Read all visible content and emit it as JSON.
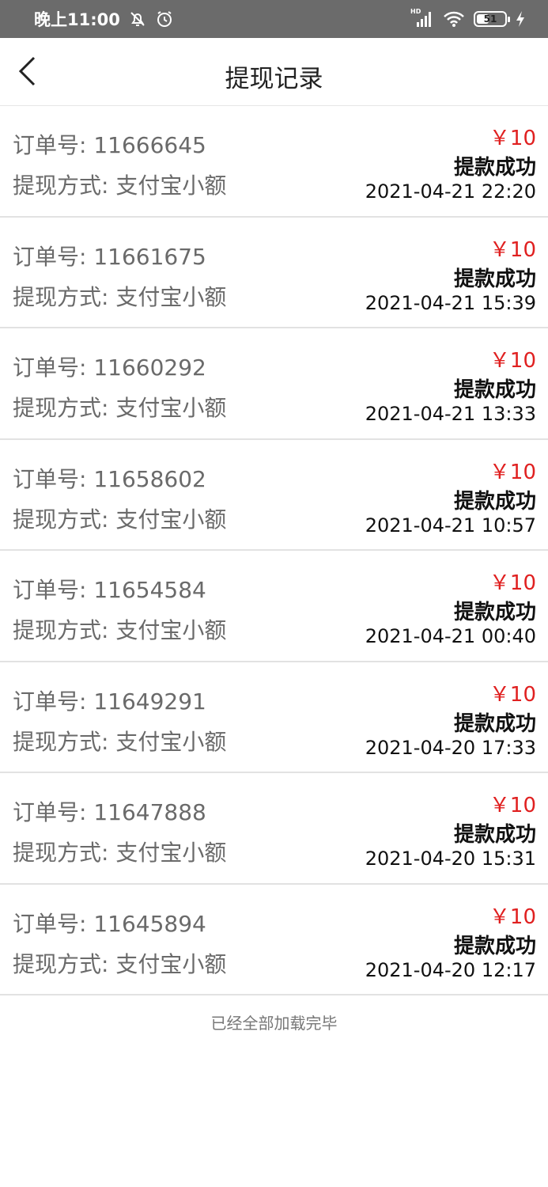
{
  "status_bar": {
    "time": "晚上11:00",
    "network_label": "HD",
    "battery_level": "51",
    "battery_percent": 51
  },
  "header": {
    "title": "提现记录"
  },
  "records": [
    {
      "order_label": "订单号: 11666645",
      "method_label": "提现方式: 支付宝小额",
      "amount": "￥10",
      "status": "提款成功",
      "time": "2021-04-21 22:20"
    },
    {
      "order_label": "订单号: 11661675",
      "method_label": "提现方式: 支付宝小额",
      "amount": "￥10",
      "status": "提款成功",
      "time": "2021-04-21 15:39"
    },
    {
      "order_label": "订单号: 11660292",
      "method_label": "提现方式: 支付宝小额",
      "amount": "￥10",
      "status": "提款成功",
      "time": "2021-04-21 13:33"
    },
    {
      "order_label": "订单号: 11658602",
      "method_label": "提现方式: 支付宝小额",
      "amount": "￥10",
      "status": "提款成功",
      "time": "2021-04-21 10:57"
    },
    {
      "order_label": "订单号: 11654584",
      "method_label": "提现方式: 支付宝小额",
      "amount": "￥10",
      "status": "提款成功",
      "time": "2021-04-21 00:40"
    },
    {
      "order_label": "订单号: 11649291",
      "method_label": "提现方式: 支付宝小额",
      "amount": "￥10",
      "status": "提款成功",
      "time": "2021-04-20 17:33"
    },
    {
      "order_label": "订单号: 11647888",
      "method_label": "提现方式: 支付宝小额",
      "amount": "￥10",
      "status": "提款成功",
      "time": "2021-04-20 15:31"
    },
    {
      "order_label": "订单号: 11645894",
      "method_label": "提现方式: 支付宝小额",
      "amount": "￥10",
      "status": "提款成功",
      "time": "2021-04-20 12:17"
    }
  ],
  "footer": {
    "text": "已经全部加载完毕"
  },
  "colors": {
    "status_bar_bg": "#6b6b6b",
    "amount": "#e02020",
    "label_gray": "#6a6a6a",
    "divider": "#e2e2e2"
  },
  "icons": {
    "back": "chevron-left-icon",
    "mute": "bell-off-icon",
    "alarm": "alarm-icon",
    "signal": "signal-icon",
    "wifi": "wifi-icon",
    "battery": "battery-icon",
    "charging": "lightning-icon"
  }
}
